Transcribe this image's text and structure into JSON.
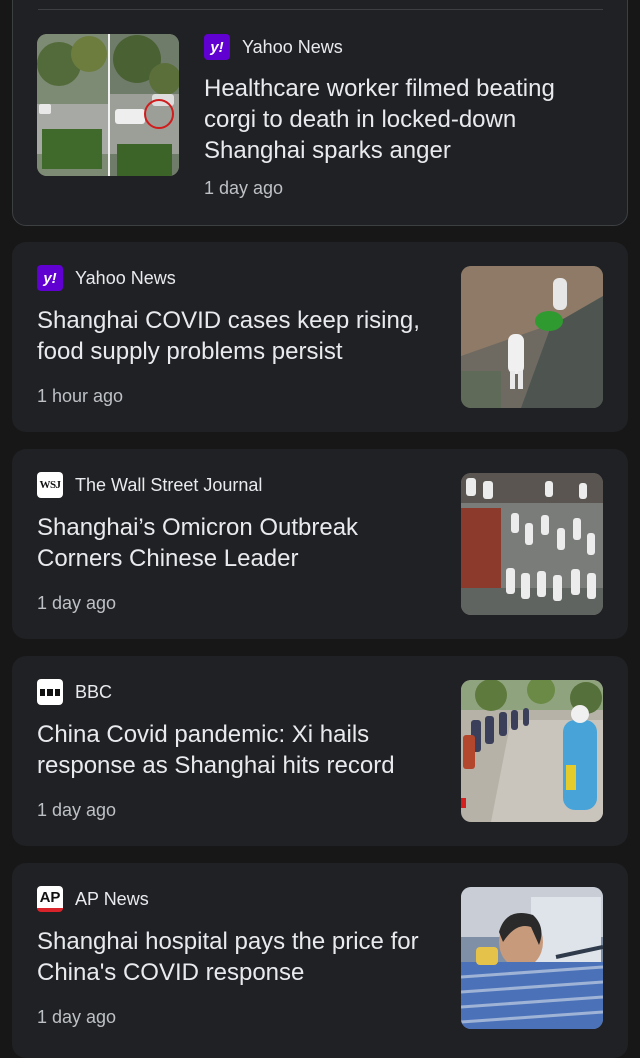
{
  "articles": [
    {
      "source": "Yahoo News",
      "logo_icon": "yahoo-logo-icon",
      "logo_text": "y!",
      "headline_lines": [
        "Healthcare worker filmed beating",
        "corgi to death in locked-down",
        "Shanghai sparks anger"
      ],
      "time": "1 day ago",
      "image": "street-split-photo"
    },
    {
      "source": "Yahoo News",
      "logo_icon": "yahoo-logo-icon",
      "logo_text": "y!",
      "headline_lines": [
        "Shanghai COVID cases keep rising,",
        "food supply problems persist"
      ],
      "time": "1 hour ago",
      "image": "hazmat-workers-photo"
    },
    {
      "source": "The Wall Street Journal",
      "logo_icon": "wsj-logo-icon",
      "logo_text": "WSJ",
      "headline_lines": [
        "Shanghai’s Omicron Outbreak",
        "Corners Chinese Leader"
      ],
      "time": "1 day ago",
      "image": "crowd-hazmat-photo"
    },
    {
      "source": "BBC",
      "logo_icon": "bbc-logo-icon",
      "logo_text": "",
      "headline_lines": [
        "China Covid pandemic: Xi hails",
        "response as Shanghai hits record"
      ],
      "time": "1 day ago",
      "image": "queue-street-photo"
    },
    {
      "source": "AP News",
      "logo_icon": "ap-logo-icon",
      "logo_text": "AP",
      "headline_lines": [
        "Shanghai hospital pays the price for",
        "China's COVID response"
      ],
      "time": "1 day ago",
      "image": "hospital-patient-photo"
    }
  ]
}
